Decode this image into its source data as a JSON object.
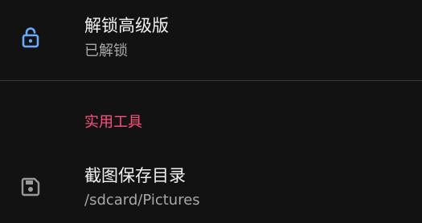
{
  "colors": {
    "background": "#121212",
    "accent_icon": "#6aa8ff",
    "category_accent": "#ff4f7f",
    "title_text": "#f2f2f2",
    "summary_text": "#a8a8a8",
    "divider": "#3a3a3a"
  },
  "unlock_pref": {
    "icon": "unlock-icon",
    "title": "解锁高级版",
    "summary": "已解锁"
  },
  "tools_category": {
    "title": "实用工具"
  },
  "save_dir_pref": {
    "icon": "save-icon",
    "title": "截图保存目录",
    "summary": "/sdcard/Pictures"
  }
}
